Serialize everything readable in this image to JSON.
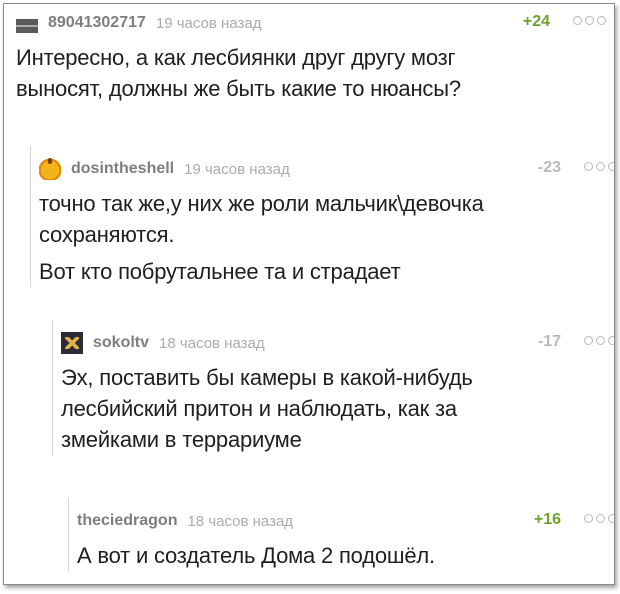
{
  "comments": [
    {
      "username": "89041302717",
      "time": "19 часов назад",
      "rating": "+24",
      "avatar_icon": "avatar-image",
      "text_lines": [
        "Интересно, а как лесбиянки друг другу мозг",
        "выносят, должны же быть какие то нюансы?"
      ]
    },
    {
      "username": "dosintheshell",
      "time": "19 часов назад",
      "rating": "-23",
      "avatar_icon": "avatar-orange-icon",
      "text_lines": [
        "точно так же,у них же роли мальчик\\девочка",
        "сохраняются."
      ],
      "text_para2": "Вот кто побрутальнее та и страдает"
    },
    {
      "username": "sokoltv",
      "time": "18 часов назад",
      "rating": "-17",
      "avatar_icon": "avatar-logo-icon",
      "text_lines": [
        "Эх, поставить бы камеры в какой-нибудь",
        "лесбийский притон и наблюдать, как за",
        "змейками в террариуме"
      ]
    },
    {
      "username": "theciedragon",
      "time": "18 часов назад",
      "rating": "+16",
      "text_lines": [
        "А вот и создатель Дома 2 подошёл."
      ]
    }
  ],
  "colors": {
    "positive_rating": "#6ba32b",
    "negative_rating": "#b9b9b9",
    "username": "#7e7e7e",
    "time": "#ababab"
  }
}
